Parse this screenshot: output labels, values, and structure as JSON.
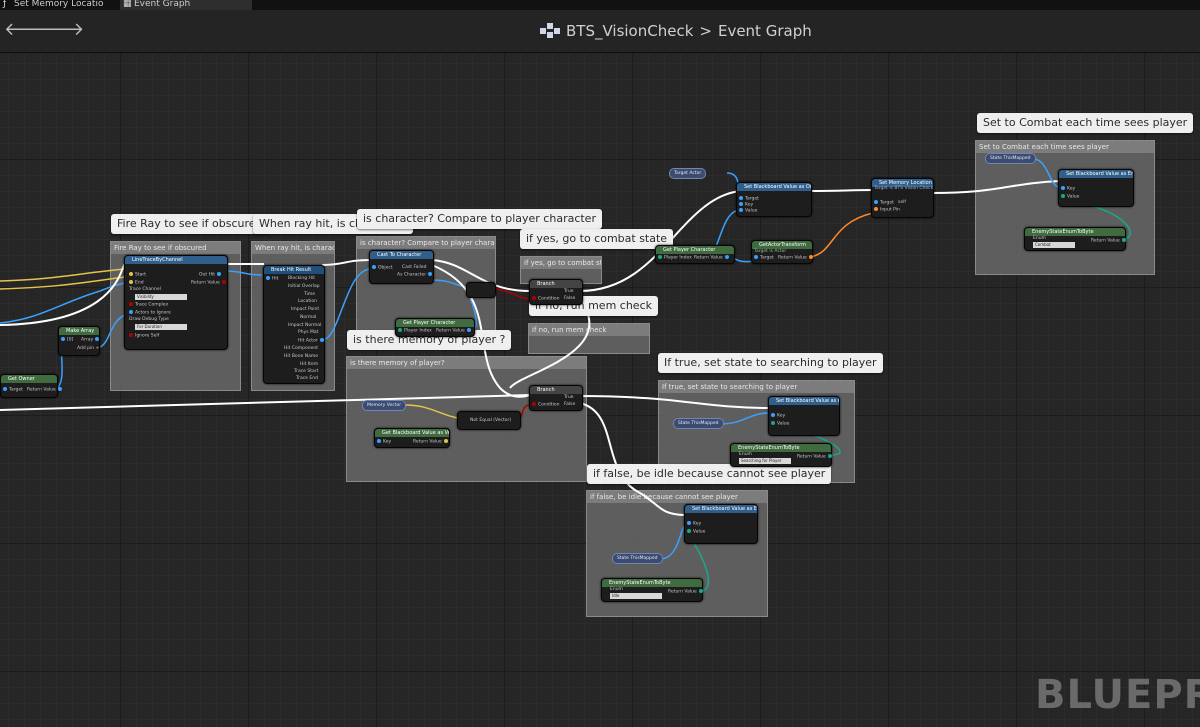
{
  "tabs": [
    {
      "label": "Set Memory Locatio"
    },
    {
      "label": "Event Graph"
    }
  ],
  "breadcrumb": {
    "asset": "BTS_VisionCheck",
    "separator": ">",
    "graph": "Event Graph"
  },
  "comments": [
    {
      "bubble": "Fire Ray to see if obscured",
      "title": "Fire Ray to see if obscured"
    },
    {
      "bubble": "When ray hit, is character?",
      "title": "When ray hit, is character?"
    },
    {
      "bubble": "is character? Compare to player character",
      "title": "is character? Compare to player character"
    },
    {
      "bubble": "if yes, go to combat state",
      "title": "if yes, go to combat state"
    },
    {
      "bubble": "if no, run mem check",
      "title": "if no, run mem check"
    },
    {
      "bubble": "is there memory of player ?",
      "title": "is there memory of player?"
    },
    {
      "bubble": "If true, set state to searching to player",
      "title": "If true, set state to searching to player"
    },
    {
      "bubble": "if false, be idle because cannot see player",
      "title": "if false, be idle because cannot see player"
    },
    {
      "bubble": "Set to Combat each time sees player",
      "title": "Set to Combat each time sees player"
    }
  ],
  "nodes": {
    "make_array": {
      "title": "Make Array",
      "pins": [
        "[0]",
        "Array",
        "Add pin +"
      ]
    },
    "line_trace": {
      "title": "LineTraceByChannel",
      "pins": [
        "Start",
        "End",
        "Trace Channel",
        "Visibility",
        "Trace Complex",
        "Actors to Ignore",
        "Draw Debug Type",
        "For Duration",
        "Ignore Self",
        "Out Hit",
        "Return Value"
      ]
    },
    "break_hit": {
      "title": "Break Hit Result",
      "pins": [
        "Hit",
        "Blocking Hit",
        "Initial Overlap",
        "Time",
        "Location",
        "Impact Point",
        "Normal",
        "Impact Normal",
        "Phys Mat",
        "Hit Actor",
        "Hit Component",
        "Hit Bone Name",
        "Hit Item",
        "Trace Start",
        "Trace End"
      ]
    },
    "cast_character": {
      "title": "Cast To Character",
      "pins": [
        "Object",
        "Cast Failed",
        "As Character"
      ]
    },
    "get_player": {
      "title": "Get Player Character",
      "pins": [
        "Player Index",
        "Return Value"
      ]
    },
    "branch1": {
      "title": "Branch",
      "pins": [
        "Condition",
        "True",
        "False"
      ]
    },
    "branch2": {
      "title": "Branch",
      "pins": [
        "Condition",
        "True",
        "False"
      ]
    },
    "mem_var": {
      "title": "Memory Vector"
    },
    "get_bb_vector": {
      "title": "Get Blackboard Value as Vector",
      "pins": [
        "Key",
        "Return Value"
      ]
    },
    "not_equal": {
      "title": "Not Equal (Vector)"
    },
    "get_owner": {
      "title": "Get Owner",
      "pins": [
        "Target",
        "Return Value"
      ]
    },
    "target_actor": {
      "title": "Target Actor"
    },
    "set_bb_object": {
      "title": "Set Blackboard Value as Object",
      "pins": [
        "Target",
        "Key",
        "Value"
      ]
    },
    "get_player2": {
      "title": "Get Player Character",
      "pins": [
        "Player Index",
        "Return Value"
      ]
    },
    "get_actor_transform": {
      "title": "GetActorTransform",
      "sub": "Target is Actor",
      "pins": [
        "Target",
        "Return Value"
      ]
    },
    "set_mem_location": {
      "title": "Set Memory Location",
      "sub": "Target is BTS Vision Check",
      "pins": [
        "Target",
        "self",
        "Input Pin"
      ]
    },
    "state_var1": {
      "title": "State ThisMapped"
    },
    "set_bb_enum1": {
      "title": "Set Blackboard Value as Enum",
      "pins": [
        "Key",
        "Value"
      ]
    },
    "enum_to_byte1": {
      "title": "EnemyStateEnumToByte",
      "pins": [
        "Enum",
        "Combat",
        "Return Value"
      ]
    },
    "state_var2": {
      "title": "State ThisMapped"
    },
    "set_bb_enum2": {
      "title": "Set Blackboard Value as Enum",
      "pins": [
        "Key",
        "Value"
      ]
    },
    "enum_to_byte2": {
      "title": "EnemyStateEnumToByte",
      "pins": [
        "Enum",
        "Searching for Player",
        "Return Value"
      ]
    },
    "state_var3": {
      "title": "State ThisMapped"
    },
    "set_bb_enum3": {
      "title": "Set Blackboard Value as Enum",
      "pins": [
        "Key",
        "Value"
      ]
    },
    "enum_to_byte3": {
      "title": "EnemyStateEnumToByte",
      "pins": [
        "Enum",
        "Idle",
        "Return Value"
      ]
    }
  },
  "watermark": "BLUEPR",
  "colors": {
    "exec_wire": "#ffffff",
    "object_wire": "#3ba0ff",
    "vector_wire": "#e6c34a",
    "bool_wire": "#8b0000",
    "byte_wire": "#18a88a",
    "struct_wire": "#ff8a2a",
    "function_header": "#2f5f8a",
    "pure_header": "#3f6b3f",
    "cast_header": "#2f5f8a"
  }
}
